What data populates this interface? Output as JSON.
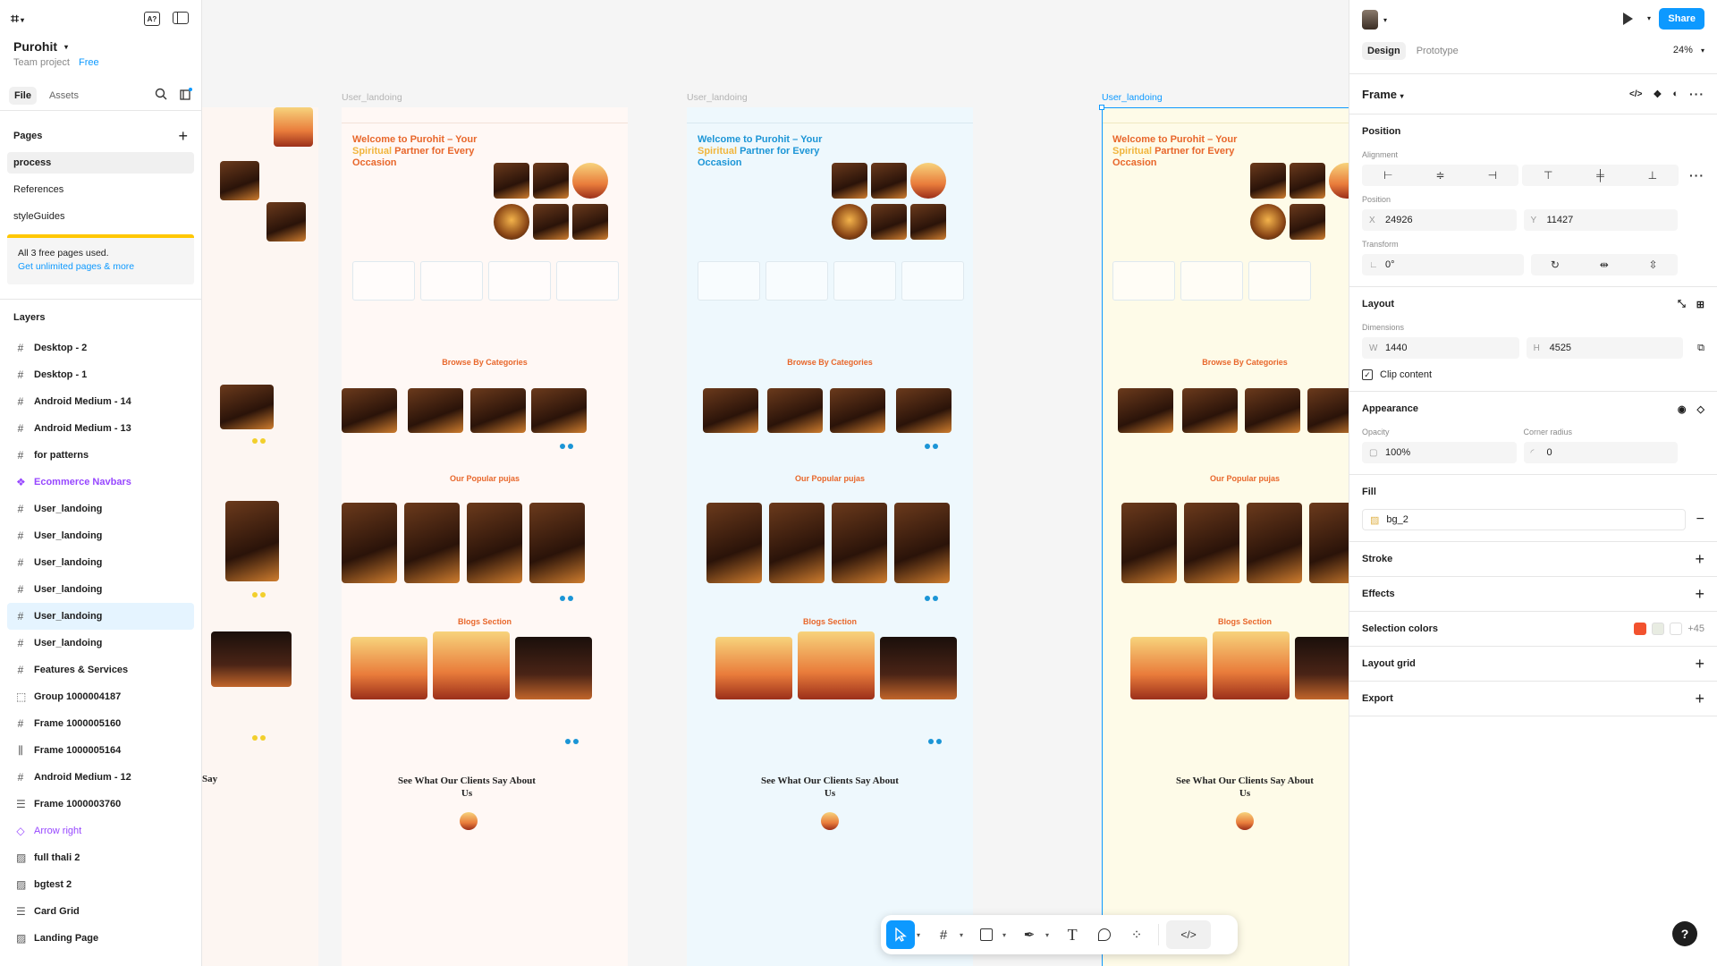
{
  "app": {
    "project_name": "Purohit",
    "team": "Team project",
    "plan": "Free"
  },
  "left": {
    "tabs": [
      "File",
      "Assets"
    ],
    "pages_title": "Pages",
    "pages": [
      "process",
      "References",
      "styleGuides"
    ],
    "upgrade_text": "All 3 free pages used.",
    "upgrade_link": "Get unlimited pages & more",
    "layers_title": "Layers",
    "layers": [
      {
        "name": "Desktop - 2",
        "type": "frame"
      },
      {
        "name": "Desktop - 1",
        "type": "frame"
      },
      {
        "name": "Android Medium - 14",
        "type": "frame"
      },
      {
        "name": "Android Medium - 13",
        "type": "frame"
      },
      {
        "name": "for patterns",
        "type": "frame"
      },
      {
        "name": "Ecommerce Navbars",
        "type": "component"
      },
      {
        "name": "User_landoing",
        "type": "frame"
      },
      {
        "name": "User_landoing",
        "type": "frame"
      },
      {
        "name": "User_landoing",
        "type": "frame"
      },
      {
        "name": "User_landoing",
        "type": "frame"
      },
      {
        "name": "User_landoing",
        "type": "frame",
        "selected": true
      },
      {
        "name": "User_landoing",
        "type": "frame"
      },
      {
        "name": "Features & Services",
        "type": "frame"
      },
      {
        "name": "Group 1000004187",
        "type": "group"
      },
      {
        "name": "Frame 1000005160",
        "type": "frame"
      },
      {
        "name": "Frame 1000005164",
        "type": "autolayout"
      },
      {
        "name": "Android Medium - 12",
        "type": "frame"
      },
      {
        "name": "Frame 1000003760",
        "type": "stack"
      },
      {
        "name": "Arrow right",
        "type": "vector"
      },
      {
        "name": "full thali 2",
        "type": "image"
      },
      {
        "name": "bgtest 2",
        "type": "image"
      },
      {
        "name": "Card Grid",
        "type": "stack"
      },
      {
        "name": "Landing Page",
        "type": "image"
      }
    ]
  },
  "canvas": {
    "frame_labels": [
      "User_landoing",
      "User_landoing",
      "User_landoing"
    ],
    "hero_title_a": "Welcome to Purohit – Your ",
    "hero_title_b": "Spiritual",
    "hero_title_c": "Partner for Every Occasion",
    "browse_title": "Browse By Categories",
    "popular_title": "Our Popular pujas",
    "blogs_title": "Blogs Section",
    "testimonial_title": "See What Our Clients Say About Us",
    "partial_title": "Say"
  },
  "toolbar": {
    "tools": [
      "move-tool",
      "frame-tool",
      "shape-tool",
      "pen-tool",
      "text-tool",
      "comment-tool",
      "actions-tool",
      "dev-mode-toggle"
    ]
  },
  "right": {
    "share_label": "Share",
    "tabs": [
      "Design",
      "Prototype"
    ],
    "zoom": "24%",
    "selection_type": "Frame",
    "position": {
      "title": "Position",
      "alignment_label": "Alignment",
      "position_label": "Position",
      "x_label": "X",
      "x": "24926",
      "y_label": "Y",
      "y": "11427",
      "transform_label": "Transform",
      "rotation": "0°"
    },
    "layout": {
      "title": "Layout",
      "dimensions_label": "Dimensions",
      "w_label": "W",
      "w": "1440",
      "h_label": "H",
      "h": "4525",
      "clip_label": "Clip content"
    },
    "appearance": {
      "title": "Appearance",
      "opacity_label": "Opacity",
      "opacity": "100%",
      "radius_label": "Corner radius",
      "radius": "0"
    },
    "fill": {
      "title": "Fill",
      "style": "bg_2"
    },
    "sections": [
      "Stroke",
      "Effects"
    ],
    "selection_colors": {
      "title": "Selection colors",
      "more": "+45",
      "colors": [
        "#f2522e",
        "#e8ece2",
        "#ffffff"
      ]
    },
    "lower_sections": [
      "Layout grid",
      "Export"
    ],
    "help": "?"
  }
}
